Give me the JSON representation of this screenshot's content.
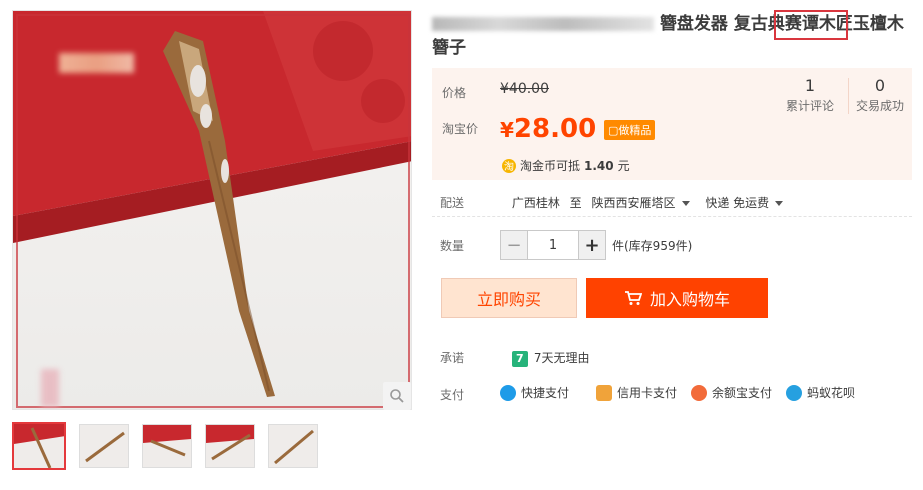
{
  "title": {
    "line1_visible": "簪盘发器 复古典",
    "highlighted": "赛谭木匠",
    "line1_tail": "玉檀木",
    "line2": "簪子"
  },
  "price": {
    "label": "价格",
    "original": "¥40.00",
    "tb_label": "淘宝价",
    "currency": "¥",
    "current": "28.00",
    "badge": "做精品"
  },
  "stats": [
    {
      "count": "1",
      "label": "累计评论"
    },
    {
      "count": "0",
      "label": "交易成功"
    }
  ],
  "coin": {
    "icon_text": "淘",
    "text": "淘金币可抵",
    "amount": "1.40",
    "unit": "元"
  },
  "delivery": {
    "label": "配送",
    "from": "广西桂林",
    "to_word": "至",
    "to": "陕西西安雁塔区",
    "shipping": "快递 免运费"
  },
  "quantity": {
    "label": "数量",
    "minus": "−",
    "value": "1",
    "plus": "+",
    "stock": "件(库存959件)"
  },
  "actions": {
    "buy": "立即购买",
    "cart": "加入购物车"
  },
  "promise": {
    "label": "承诺",
    "icon_text": "7",
    "text": "7天无理由"
  },
  "payment": {
    "label": "支付",
    "methods": [
      "快捷支付",
      "信用卡支付",
      "余额宝支付",
      "蚂蚁花呗"
    ]
  },
  "colors": {
    "accent": "#ff4400",
    "cart": "#ff4200",
    "price_bg": "#fdf3ee",
    "highlight_box": "#d9363e"
  }
}
